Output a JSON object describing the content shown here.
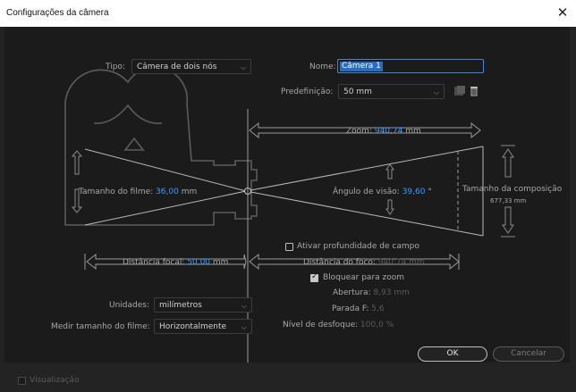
{
  "window": {
    "title": "Configurações da câmera",
    "close_icon": "close-icon"
  },
  "tipo": {
    "label": "Tipo:",
    "value": "Câmera de dois nós"
  },
  "nome": {
    "label": "Nome:",
    "value": "Câmera 1"
  },
  "predefinicao": {
    "label": "Predefinição:",
    "value": "50 mm"
  },
  "zoom": {
    "label": "Zoom:",
    "value": "940,74",
    "unit": "mm"
  },
  "film_size": {
    "label": "Tamanho do filme:",
    "value": "36,00",
    "unit": "mm"
  },
  "view_angle": {
    "label": "Ângulo de visão:",
    "value": "39,60",
    "unit": "°"
  },
  "comp_size": {
    "label": "Tamanho da composição",
    "value": "677,33 mm"
  },
  "depth_of_field": {
    "label": "Ativar profundidade de campo",
    "checked": false
  },
  "focal_distance": {
    "label": "Distância focal:",
    "value": "50,00",
    "unit": "mm"
  },
  "focus_distance": {
    "label": "Distância do foco:",
    "value": "940,74 mm"
  },
  "lock_zoom": {
    "label": "Bloquear para zoom",
    "checked": true
  },
  "aperture": {
    "label": "Abertura:",
    "value": "8,93 mm"
  },
  "f_stop": {
    "label": "Parada F:",
    "value": "5,6"
  },
  "blur_level": {
    "label": "Nível de desfoque:",
    "value": "100,0 %"
  },
  "units": {
    "label": "Unidades:",
    "value": "milímetros"
  },
  "measure_film": {
    "label": "Medir tamanho do filme:",
    "value": "Horizontalmente"
  },
  "preview": {
    "label": "Visualização",
    "checked": false
  },
  "buttons": {
    "ok": "OK",
    "cancel": "Cancelar"
  },
  "colors": {
    "accent": "#3d9bff",
    "background": "#232323",
    "panel": "#1b1b1b"
  }
}
